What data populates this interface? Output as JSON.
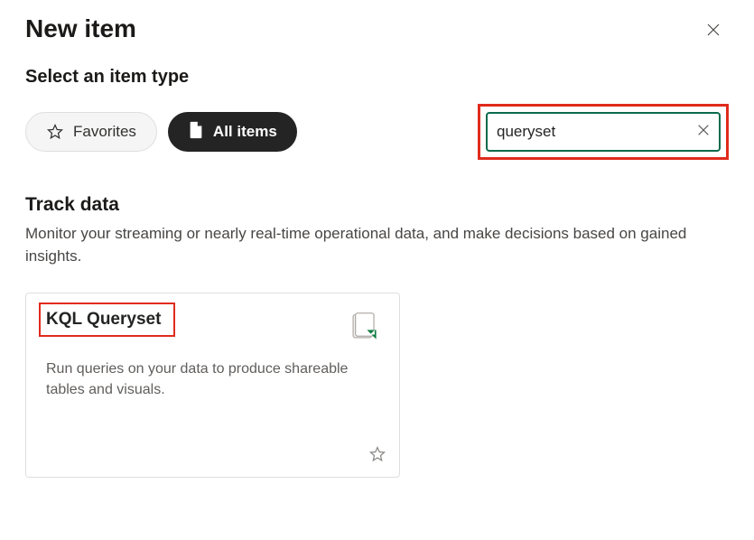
{
  "header": {
    "title": "New item"
  },
  "subtitle": "Select an item type",
  "filters": {
    "favorites_label": "Favorites",
    "allitems_label": "All items"
  },
  "search": {
    "value": "queryset"
  },
  "section": {
    "title": "Track data",
    "description": "Monitor your streaming or nearly real-time operational data, and make decisions based on gained insights."
  },
  "card": {
    "title": "KQL Queryset",
    "description": "Run queries on your data to produce shareable tables and visuals."
  }
}
